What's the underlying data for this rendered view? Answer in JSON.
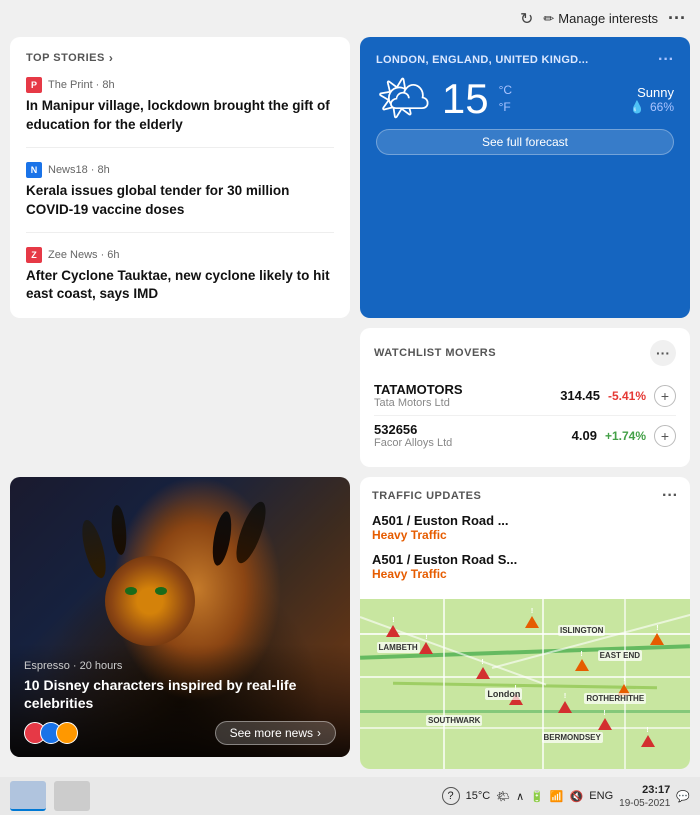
{
  "topbar": {
    "refresh_label": "↻",
    "manage_interests_label": "Manage interests",
    "pencil_icon": "✏",
    "more_icon": "···"
  },
  "top_stories": {
    "header_label": "TOP STORIES",
    "chevron": "›",
    "items": [
      {
        "source": "The Print",
        "source_short": "P",
        "source_color": "#e63946",
        "time": "8h",
        "headline": "In Manipur village, lockdown brought the gift of education for the elderly"
      },
      {
        "source": "News18",
        "source_short": "N",
        "source_color": "#1a73e8",
        "time": "8h",
        "headline": "Kerala issues global tender for 30 million COVID-19 vaccine doses"
      },
      {
        "source": "Zee News",
        "source_short": "Z",
        "source_color": "#e63946",
        "time": "6h",
        "headline": "After Cyclone Tauktae, new cyclone likely to hit east coast, says IMD"
      }
    ]
  },
  "weather": {
    "location": "LONDON, ENGLAND, UNITED KINGD...",
    "temperature": "15",
    "unit_c": "°C",
    "unit_f": "°F",
    "condition": "Sunny",
    "humidity": "66%",
    "forecast_btn": "See full forecast",
    "sun_icon": "🌤",
    "drop_icon": "💧"
  },
  "watchlist": {
    "title": "WATCHLIST MOVERS",
    "more_icon": "···",
    "stocks": [
      {
        "ticker": "TATAMOTORS",
        "fullname": "Tata Motors Ltd",
        "price": "314.45",
        "change": "-5.41%",
        "change_type": "neg"
      },
      {
        "ticker": "532656",
        "fullname": "Facor Alloys Ltd",
        "price": "4.09",
        "change": "+1.74%",
        "change_type": "pos"
      }
    ]
  },
  "disney_card": {
    "source": "Espresso · 20 hours",
    "headline": "10 Disney characters inspired by real-life celebrities",
    "see_more_label": "See more news",
    "chevron": "›"
  },
  "traffic": {
    "title": "TRAFFIC UPDATES",
    "more_icon": "···",
    "routes": [
      {
        "name": "A501 / Euston Road ...",
        "status": "Heavy Traffic"
      },
      {
        "name": "A501 / Euston Road S...",
        "status": "Heavy Traffic"
      }
    ],
    "map_label": "London"
  },
  "taskbar": {
    "time": "23:17",
    "date": "19-05-2021",
    "weather_temp": "15°C",
    "lang": "ENG",
    "help_icon": "?",
    "notification_icon": "🔔"
  }
}
